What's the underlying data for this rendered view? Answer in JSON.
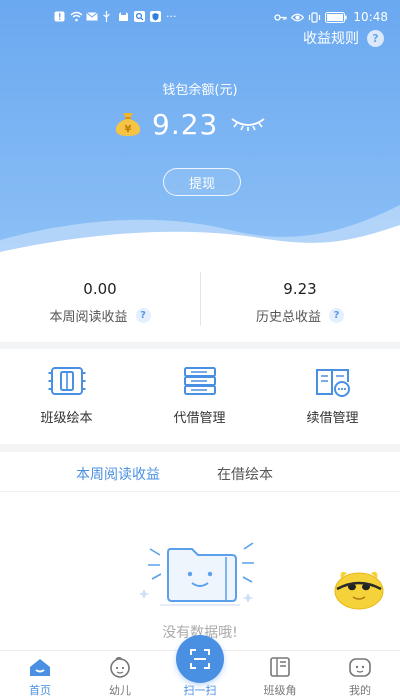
{
  "status_bar": {
    "time": "10:48",
    "more": "···"
  },
  "header": {
    "rules_link": "收益规则",
    "help_symbol": "?",
    "wallet_label": "钱包余额(元)",
    "balance": "9.23",
    "withdraw_button": "提现"
  },
  "stats": [
    {
      "value": "0.00",
      "label": "本周阅读收益",
      "help": "?"
    },
    {
      "value": "9.23",
      "label": "历史总收益",
      "help": "?"
    }
  ],
  "actions": [
    {
      "label": "班级绘本",
      "icon": "class-books-icon"
    },
    {
      "label": "代借管理",
      "icon": "proxy-borrow-icon"
    },
    {
      "label": "续借管理",
      "icon": "renew-borrow-icon"
    }
  ],
  "tabs": [
    {
      "label": "本周阅读收益",
      "active": true
    },
    {
      "label": "在借绘本",
      "active": false
    }
  ],
  "empty_state": {
    "message": "没有数据哦!"
  },
  "bottom_nav": [
    {
      "label": "首页",
      "icon": "home-icon",
      "active": true
    },
    {
      "label": "幼儿",
      "icon": "child-icon",
      "active": false
    },
    {
      "label": "扫一扫",
      "icon": "scan-icon",
      "active": false
    },
    {
      "label": "班级角",
      "icon": "class-corner-icon",
      "active": false
    },
    {
      "label": "我的",
      "icon": "profile-icon",
      "active": false
    }
  ],
  "colors": {
    "primary": "#4a90e2",
    "header_gradient_top": "#6aa8f0",
    "header_gradient_bottom": "#8cc0f6"
  }
}
